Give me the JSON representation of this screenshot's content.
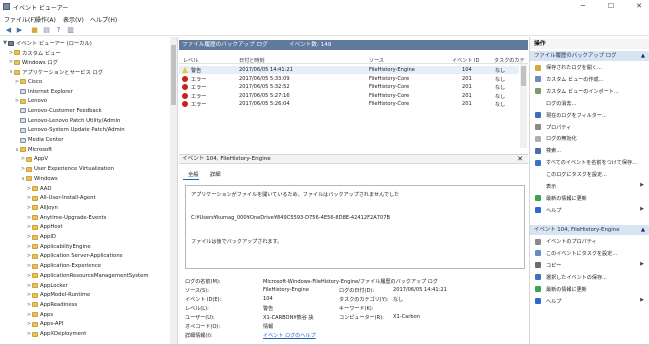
{
  "window": {
    "title": "イベント ビューアー",
    "minimize": "─",
    "maximize": "☐",
    "close": "✕"
  },
  "menu": [
    "ファイル(F)",
    "操作(A)",
    "表示(V)",
    "ヘルプ(H)"
  ],
  "toolbar": {
    "icons": [
      "back-arrow-icon",
      "forward-arrow-icon",
      "folder-icon",
      "properties-icon",
      "help-icon",
      "panel-icon"
    ]
  },
  "tree": {
    "items": [
      {
        "label": "イベント ビューアー (ローカル)",
        "depth": 0,
        "twisty": "▼",
        "icon": "root"
      },
      {
        "label": "カスタム ビュー",
        "depth": 1,
        "twisty": ">",
        "icon": "folder"
      },
      {
        "label": "Windows ログ",
        "depth": 1,
        "twisty": ">",
        "icon": "folder"
      },
      {
        "label": "アプリケーションとサービス ログ",
        "depth": 1,
        "twisty": "∨",
        "icon": "folder"
      },
      {
        "label": "Cisco",
        "depth": 2,
        "twisty": ">",
        "icon": "folder"
      },
      {
        "label": "Internet Explorer",
        "depth": 2,
        "twisty": "",
        "icon": "log"
      },
      {
        "label": "Lenovo",
        "depth": 2,
        "twisty": ">",
        "icon": "folder"
      },
      {
        "label": "Lenovo-Customer Feedback",
        "depth": 2,
        "twisty": "",
        "icon": "log"
      },
      {
        "label": "Lenovo-Lenovo Patch Utility/Admin",
        "depth": 2,
        "twisty": "",
        "icon": "log"
      },
      {
        "label": "Lenovo-System Update Patch/Admin",
        "depth": 2,
        "twisty": "",
        "icon": "log"
      },
      {
        "label": "Media Center",
        "depth": 2,
        "twisty": "",
        "icon": "log"
      },
      {
        "label": "Microsoft",
        "depth": 2,
        "twisty": "∨",
        "icon": "folder"
      },
      {
        "label": "AppV",
        "depth": 3,
        "twisty": ">",
        "icon": "folder"
      },
      {
        "label": "User Experience Virtualization",
        "depth": 3,
        "twisty": ">",
        "icon": "folder"
      },
      {
        "label": "Windows",
        "depth": 3,
        "twisty": "∨",
        "icon": "folder"
      },
      {
        "label": "AAD",
        "depth": 4,
        "twisty": ">",
        "icon": "folder"
      },
      {
        "label": "All-User-Install-Agent",
        "depth": 4,
        "twisty": ">",
        "icon": "folder"
      },
      {
        "label": "AllJoyn",
        "depth": 4,
        "twisty": ">",
        "icon": "folder"
      },
      {
        "label": "Anytime-Upgrade-Events",
        "depth": 4,
        "twisty": ">",
        "icon": "folder"
      },
      {
        "label": "AppHost",
        "depth": 4,
        "twisty": ">",
        "icon": "folder"
      },
      {
        "label": "AppID",
        "depth": 4,
        "twisty": ">",
        "icon": "folder"
      },
      {
        "label": "ApplicabilityEngine",
        "depth": 4,
        "twisty": ">",
        "icon": "folder"
      },
      {
        "label": "Application Server-Applications",
        "depth": 4,
        "twisty": ">",
        "icon": "folder"
      },
      {
        "label": "Application-Experience",
        "depth": 4,
        "twisty": ">",
        "icon": "folder"
      },
      {
        "label": "ApplicationResourceManagementSystem",
        "depth": 4,
        "twisty": ">",
        "icon": "folder"
      },
      {
        "label": "AppLocker",
        "depth": 4,
        "twisty": ">",
        "icon": "folder"
      },
      {
        "label": "AppModel-Runtime",
        "depth": 4,
        "twisty": ">",
        "icon": "folder"
      },
      {
        "label": "AppReadiness",
        "depth": 4,
        "twisty": ">",
        "icon": "folder"
      },
      {
        "label": "Apps",
        "depth": 4,
        "twisty": ">",
        "icon": "folder"
      },
      {
        "label": "Apps-API",
        "depth": 4,
        "twisty": ">",
        "icon": "folder"
      },
      {
        "label": "AppXDeployment",
        "depth": 4,
        "twisty": ">",
        "icon": "folder"
      }
    ]
  },
  "log_header": {
    "name": "ファイル履歴のバックアップ ログ",
    "count": "イベント数: 149"
  },
  "columns": [
    "レベル",
    "日付と時刻",
    "ソース",
    "イベント ID",
    "タスクのカテ"
  ],
  "events": [
    {
      "level": "warn",
      "level_text": "警告",
      "datetime": "2017/06/05 14:41:21",
      "source": "FileHistory-Engine",
      "id": "104",
      "task": "なし",
      "selected": true
    },
    {
      "level": "err",
      "level_text": "エラー",
      "datetime": "2017/06/05 5:33:09",
      "source": "FileHistory-Core",
      "id": "201",
      "task": "なし",
      "selected": false
    },
    {
      "level": "err",
      "level_text": "エラー",
      "datetime": "2017/06/05 5:32:52",
      "source": "FileHistory-Core",
      "id": "201",
      "task": "なし",
      "selected": false
    },
    {
      "level": "err",
      "level_text": "エラー",
      "datetime": "2017/06/05 5:27:16",
      "source": "FileHistory-Core",
      "id": "201",
      "task": "なし",
      "selected": false
    },
    {
      "level": "err",
      "level_text": "エラー",
      "datetime": "2017/06/05 5:26:04",
      "source": "FileHistory-Core",
      "id": "201",
      "task": "なし",
      "selected": false
    }
  ],
  "detail": {
    "header": "イベント 104, FileHistory-Engine",
    "tabs": [
      "全般",
      "詳細"
    ],
    "message_lines": [
      "アプリケーションがファイルを開いているため、ファイルはバックアップされませんでした",
      "C:¥Users¥kumag_000¥OneDrive¥849C5593-D756-4E56-8D8E-42412F2A707B",
      "ファイルは後でバックアップされます。"
    ],
    "props": {
      "log_name_label": "ログの名前(M):",
      "log_name_value": "Microsoft-Windows-FileHistory-Engine/ファイル履歴のバックアップ ログ",
      "source_label": "ソース(S):",
      "source_value": "FileHistory-Engine",
      "logged_label": "ログの日付(D):",
      "logged_value": "2017/06/05 14:41:21",
      "event_id_label": "イベント ID(E):",
      "event_id_value": "104",
      "task_label": "タスクのカテゴリ(Y):",
      "task_value": "なし",
      "level_label": "レベル(L):",
      "level_value": "警告",
      "keywords_label": "キーワード(K):",
      "keywords_value": "",
      "user_label": "ユーザー(U):",
      "user_value": "X1-CARBON¥熊谷 訣",
      "computer_label": "コンピューター(R):",
      "computer_value": "X1-Carbon",
      "opcode_label": "オペコード(O):",
      "opcode_value": "情報",
      "more_label": "詳細情報(I):",
      "more_link": "イベント ログのヘルプ"
    }
  },
  "actions": {
    "title": "操作",
    "section1": "ファイル履歴のバックアップ ログ",
    "items1": [
      {
        "label": "保存されたログを開く...",
        "icon": "#d6a73a",
        "arrow": ""
      },
      {
        "label": "カスタム ビューの作成...",
        "icon": "#6b8ac4",
        "arrow": ""
      },
      {
        "label": "カスタム ビューのインポート...",
        "icon": "#7c9a6a",
        "arrow": ""
      },
      {
        "label": "ログの消去...",
        "icon": "",
        "arrow": ""
      },
      {
        "label": "現在のログをフィルター...",
        "icon": "#3d6fb5",
        "arrow": ""
      },
      {
        "label": "プロパティ",
        "icon": "#8a8a8a",
        "arrow": ""
      },
      {
        "label": "ログの無効化",
        "icon": "#b0b0b0",
        "arrow": ""
      },
      {
        "label": "検索...",
        "icon": "#4a6fa5",
        "arrow": ""
      },
      {
        "label": "すべてのイベントを名前をつけて保存...",
        "icon": "#3a74c1",
        "arrow": ""
      },
      {
        "label": "このログにタスクを設定...",
        "icon": "",
        "arrow": ""
      },
      {
        "label": "表示",
        "icon": "",
        "arrow": "▶"
      },
      {
        "label": "最新の情報に更新",
        "icon": "#3aa655",
        "arrow": ""
      },
      {
        "label": "ヘルプ",
        "icon": "#2f6bc9",
        "arrow": "▶"
      }
    ],
    "section2": "イベント 104, FileHistory-Engine",
    "items2": [
      {
        "label": "イベントのプロパティ",
        "icon": "#8a8a8a",
        "arrow": ""
      },
      {
        "label": "このイベントにタスクを設定...",
        "icon": "#6b8ac4",
        "arrow": ""
      },
      {
        "label": "コピー",
        "icon": "#6d6d6d",
        "arrow": "▶"
      },
      {
        "label": "選択したイベントの保存...",
        "icon": "#3a74c1",
        "arrow": ""
      },
      {
        "label": "最新の情報に更新",
        "icon": "#3aa655",
        "arrow": ""
      },
      {
        "label": "ヘルプ",
        "icon": "#2f6bc9",
        "arrow": "▶"
      }
    ]
  }
}
